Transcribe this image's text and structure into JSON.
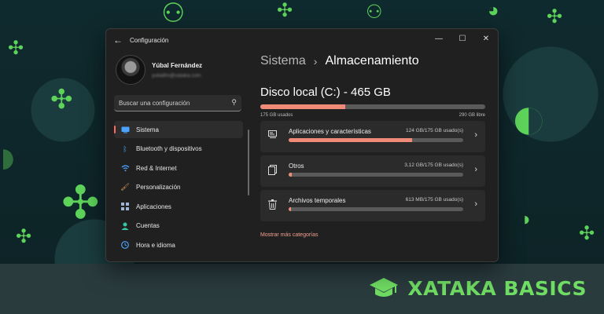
{
  "window": {
    "title": "Configuración",
    "controls": {
      "minimize": "—",
      "maximize": "☐",
      "close": "✕"
    },
    "back": "←"
  },
  "profile": {
    "name": "Yúbal Fernández",
    "email": "yubalfm@xataka.com"
  },
  "search": {
    "placeholder": "Buscar una configuración",
    "icon": "search-icon"
  },
  "nav": {
    "items": [
      {
        "label": "Sistema",
        "icon": "monitor-icon",
        "color": "#4aa3ff",
        "active": true
      },
      {
        "label": "Bluetooth y dispositivos",
        "icon": "bluetooth-icon",
        "color": "#4aa3ff"
      },
      {
        "label": "Red & Internet",
        "icon": "wifi-icon",
        "color": "#4aa3ff"
      },
      {
        "label": "Personalización",
        "icon": "brush-icon",
        "color": "#e0a060"
      },
      {
        "label": "Aplicaciones",
        "icon": "apps-icon",
        "color": "#9fb6d6"
      },
      {
        "label": "Cuentas",
        "icon": "person-icon",
        "color": "#35c7a5"
      },
      {
        "label": "Hora e idioma",
        "icon": "globe-clock-icon",
        "color": "#4aa3ff"
      }
    ]
  },
  "main": {
    "breadcrumb": {
      "parent": "Sistema",
      "separator": "›",
      "current": "Almacenamiento"
    },
    "disk": {
      "title": "Disco local (C:) - 465 GB",
      "used_label": "175 GB usados",
      "free_label": "290 GB libre",
      "used_fraction": 0.376
    },
    "categories": [
      {
        "name": "Aplicaciones y características",
        "size": "124 GB/175 GB usado(s)",
        "fraction": 0.709,
        "icon": "apps-list-icon"
      },
      {
        "name": "Otros",
        "size": "3,12 GB/175 GB usado(s)",
        "fraction": 0.018,
        "icon": "files-icon"
      },
      {
        "name": "Archivos temporales",
        "size": "613 MB/175 GB usado(s)",
        "fraction": 0.0035,
        "icon": "trash-icon"
      }
    ],
    "more_link": "Mostrar más categorías"
  },
  "brand": {
    "text": "XATAKA BASICS",
    "color": "#6fdc63"
  }
}
